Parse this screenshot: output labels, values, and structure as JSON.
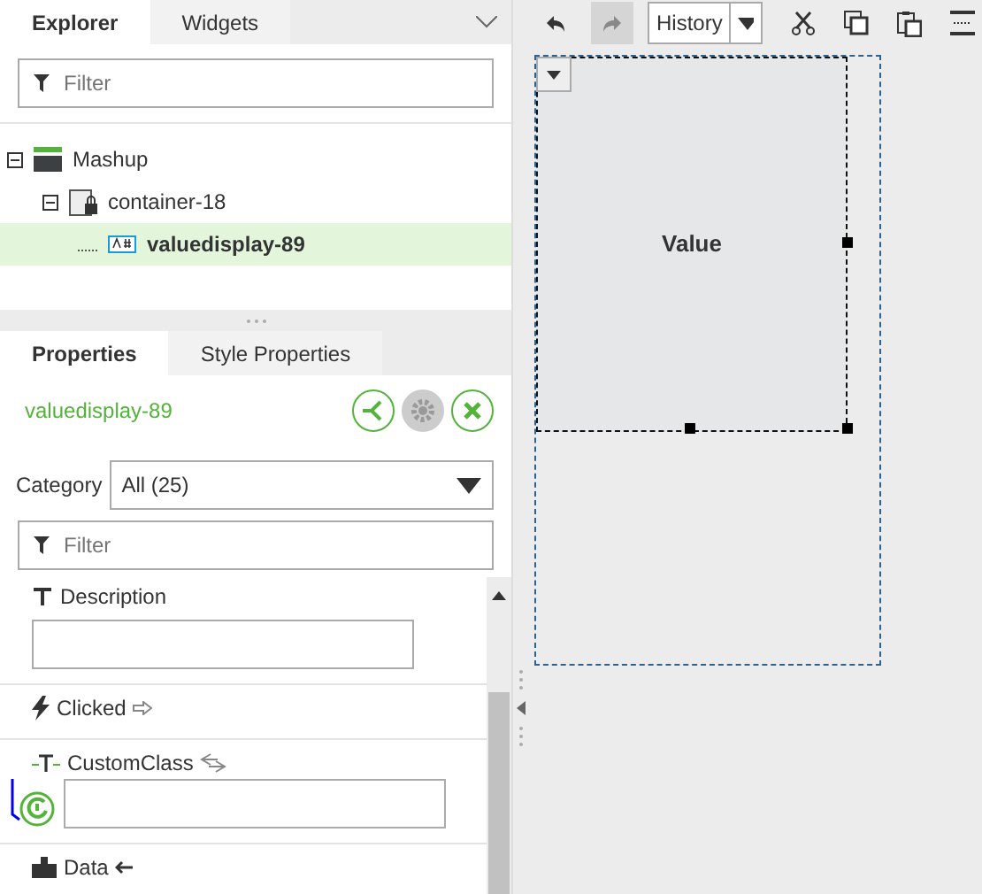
{
  "explorer_tabs": [
    {
      "label": "Explorer",
      "selected": true
    },
    {
      "label": "Widgets",
      "selected": false
    }
  ],
  "explorer_filter": {
    "placeholder": "Filter"
  },
  "tree": [
    {
      "label": "Mashup",
      "kind": "mashup",
      "expanded": true,
      "selected": false,
      "children": [
        {
          "label": "container-18",
          "kind": "container",
          "expanded": true,
          "selected": false,
          "children": [
            {
              "label": "valuedisplay-89",
              "kind": "valuedisplay",
              "selected": true
            }
          ]
        }
      ]
    }
  ],
  "toolbar": {
    "history": "History",
    "buttons": [
      {
        "kind": "undo",
        "disabled": false
      },
      {
        "kind": "redo",
        "disabled": true
      }
    ]
  },
  "properties_tabs": [
    {
      "label": "Properties",
      "selected": true
    },
    {
      "label": "Style Properties",
      "selected": false
    }
  ],
  "widget_name": "valuedisplay-89",
  "category": {
    "label": "Category",
    "value": "All (25)"
  },
  "property_filter": {
    "placeholder": "Filter"
  },
  "properties": [
    {
      "name": "Description",
      "kind": "text"
    },
    {
      "name": "Clicked",
      "kind": "event"
    },
    {
      "name": "CustomClass",
      "kind": "bindable"
    },
    {
      "name": "Data",
      "kind": "data"
    }
  ],
  "canvas": {
    "widget_label": "Value"
  }
}
